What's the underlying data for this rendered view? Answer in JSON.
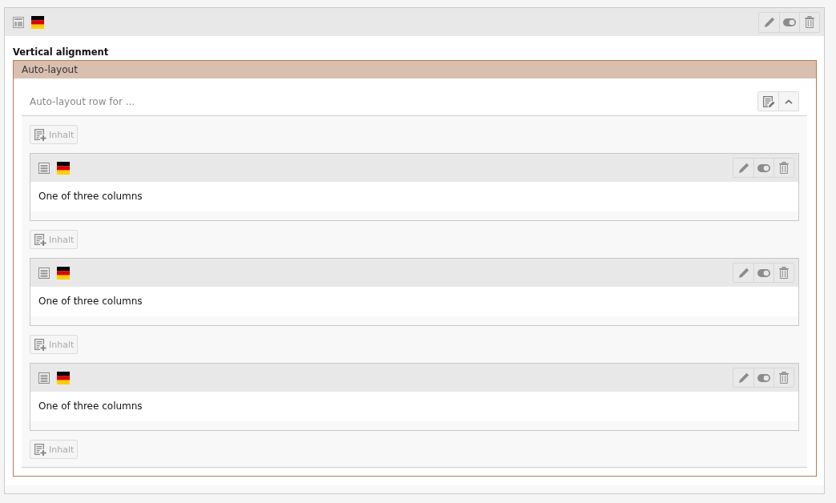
{
  "section": {
    "title": "Vertical alignment"
  },
  "container": {
    "title": "Auto-layout",
    "row": {
      "label": "Auto-layout row for ...",
      "expanded": true,
      "items": [
        {
          "kind": "add_button",
          "label": "Inhalt"
        },
        {
          "kind": "content_element",
          "text": "One of three columns"
        },
        {
          "kind": "add_button",
          "label": "Inhalt"
        },
        {
          "kind": "content_element",
          "text": "One of three columns"
        },
        {
          "kind": "add_button",
          "label": "Inhalt"
        },
        {
          "kind": "content_element",
          "text": "One of three columns"
        },
        {
          "kind": "add_button",
          "label": "Inhalt"
        }
      ]
    }
  }
}
